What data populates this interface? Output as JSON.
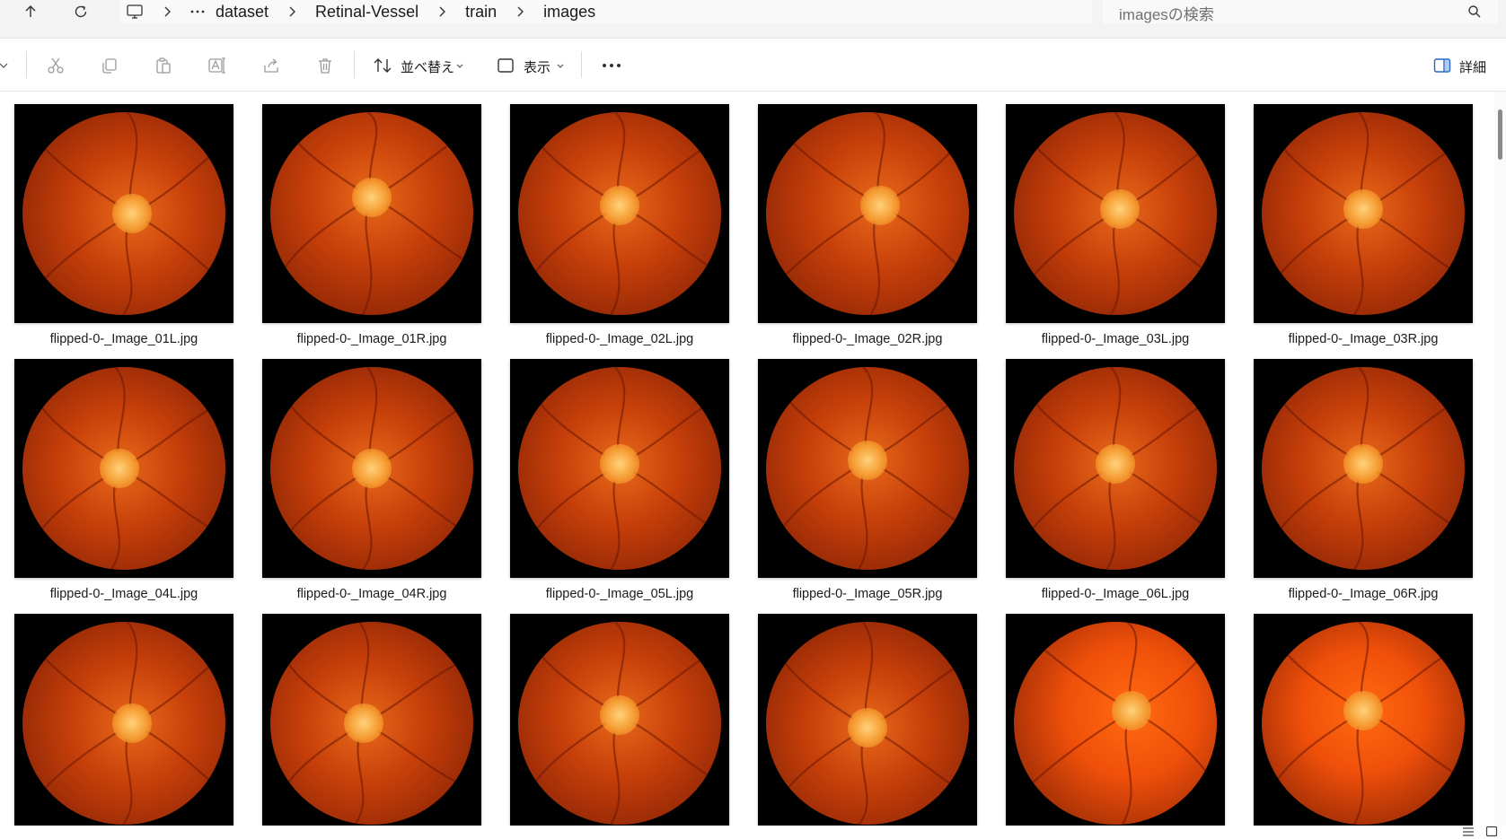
{
  "nav": {
    "up_icon": "arrow-up-icon",
    "refresh_icon": "refresh-icon",
    "pc_icon": "computer-icon",
    "more_icon": "ellipsis-icon"
  },
  "breadcrumb": [
    "dataset",
    "Retinal-Vessel",
    "train",
    "images"
  ],
  "search": {
    "placeholder": "imagesの検索"
  },
  "toolbar": {
    "sort_label": "並べ替え",
    "view_label": "表示",
    "details_label": "詳細"
  },
  "files": [
    "flipped-0-_Image_01L.jpg",
    "flipped-0-_Image_01R.jpg",
    "flipped-0-_Image_02L.jpg",
    "flipped-0-_Image_02R.jpg",
    "flipped-0-_Image_03L.jpg",
    "flipped-0-_Image_03R.jpg",
    "flipped-0-_Image_04L.jpg",
    "flipped-0-_Image_04R.jpg",
    "flipped-0-_Image_05L.jpg",
    "flipped-0-_Image_05R.jpg",
    "flipped-0-_Image_06L.jpg",
    "flipped-0-_Image_06R.jpg",
    "",
    "",
    "",
    "",
    "",
    ""
  ],
  "colors": {
    "fundus_dark": "#7a1c04",
    "fundus_mid": "#c8400a",
    "fundus_light": "#e86a1a",
    "disc": "#ffd27a"
  }
}
